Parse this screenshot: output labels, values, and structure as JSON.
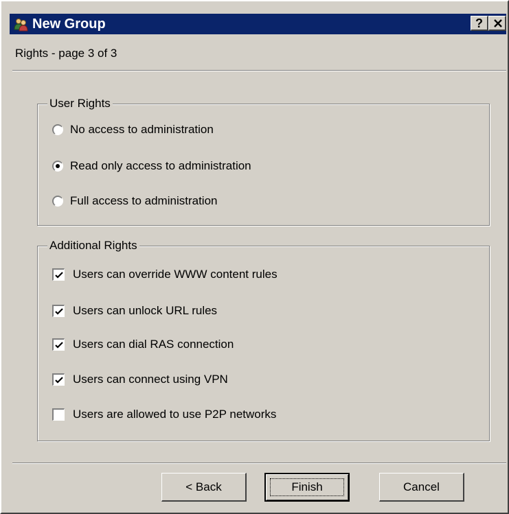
{
  "window": {
    "title": "New Group",
    "help_label": "?",
    "close_label": "✕"
  },
  "page": {
    "subtitle": "Rights - page 3 of 3"
  },
  "user_rights": {
    "legend": "User Rights",
    "options": [
      {
        "label": "No access to administration",
        "checked": false
      },
      {
        "label": "Read only access to administration",
        "checked": true
      },
      {
        "label": "Full access to administration",
        "checked": false
      }
    ]
  },
  "additional_rights": {
    "legend": "Additional Rights",
    "options": [
      {
        "label": "Users can override WWW content rules",
        "checked": true
      },
      {
        "label": "Users can unlock URL rules",
        "checked": true
      },
      {
        "label": "Users can dial RAS connection",
        "checked": true
      },
      {
        "label": "Users can connect using VPN",
        "checked": true
      },
      {
        "label": "Users are allowed to use P2P networks",
        "checked": false
      }
    ]
  },
  "buttons": {
    "back": "< Back",
    "finish": "Finish",
    "cancel": "Cancel"
  },
  "colors": {
    "titlebar": "#0a246a",
    "face": "#d4d0c8"
  }
}
